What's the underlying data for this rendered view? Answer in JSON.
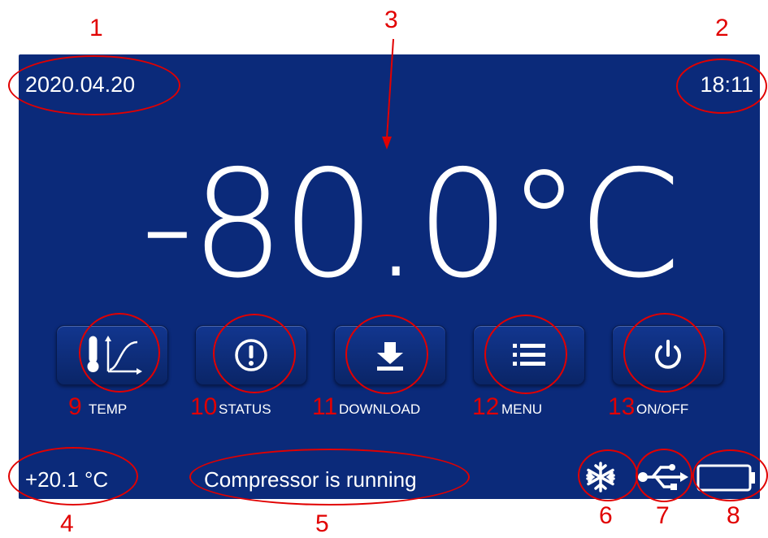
{
  "screen": {
    "date": "2020.04.20",
    "time": "18:11",
    "setpoint_temp": "-80.0°C",
    "ambient_temp": "+20.1 °C",
    "status_message": "Compressor is running"
  },
  "buttons": [
    {
      "label": "TEMP",
      "icon": "thermometer-graph-icon"
    },
    {
      "label": "STATUS",
      "icon": "alert-circle-icon"
    },
    {
      "label": "DOWNLOAD",
      "icon": "download-icon"
    },
    {
      "label": "MENU",
      "icon": "menu-list-icon"
    },
    {
      "label": "ON/OFF",
      "icon": "power-icon"
    }
  ],
  "status_icons": [
    "snowflake-icon",
    "usb-icon",
    "battery-icon"
  ],
  "annotations": {
    "n1": "1",
    "n2": "2",
    "n3": "3",
    "n4": "4",
    "n5": "5",
    "n6": "6",
    "n7": "7",
    "n8": "8",
    "n9": "9",
    "n10": "10",
    "n11": "11",
    "n12": "12",
    "n13": "13"
  },
  "colors": {
    "panel_bg": "#0b2a7a",
    "text": "#ffffff",
    "annotation": "#e10000"
  }
}
